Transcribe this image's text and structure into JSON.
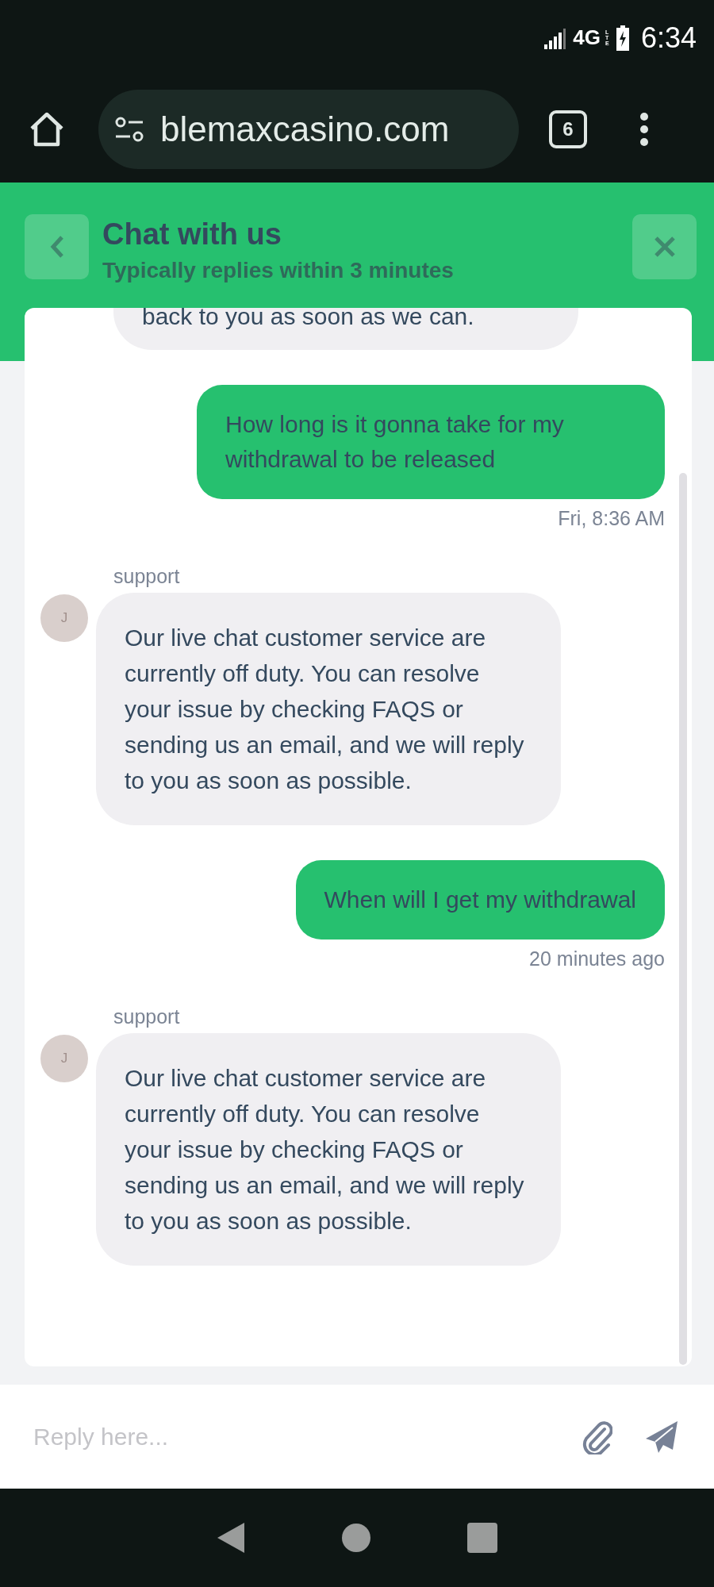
{
  "status_bar": {
    "network": "4G",
    "network_sub": "LTE",
    "time": "6:34"
  },
  "browser": {
    "url": "blemaxcasino.com",
    "tab_count": "6"
  },
  "header": {
    "title": "Chat with us",
    "subtitle": "Typically replies within 3 minutes"
  },
  "messages": [
    {
      "kind": "incoming",
      "text": "back to you as soon as we can."
    },
    {
      "kind": "outgoing",
      "text": "How long is it gonna take for my withdrawal to be released",
      "time": "Fri, 8:36 AM"
    },
    {
      "kind": "incoming",
      "sender": "support",
      "avatar": "J",
      "text": "Our live chat customer service are currently off duty. You can resolve your issue by checking FAQS or sending us an email, and we will reply to you as soon as possible."
    },
    {
      "kind": "outgoing",
      "text": "When will I get my withdrawal",
      "time": "20 minutes ago"
    },
    {
      "kind": "incoming",
      "sender": "support",
      "avatar": "J",
      "text": "Our live chat customer service are currently off duty. You can resolve your issue by checking FAQS or sending us an email, and we will reply to you as soon as possible."
    }
  ],
  "reply": {
    "placeholder": "Reply here..."
  }
}
